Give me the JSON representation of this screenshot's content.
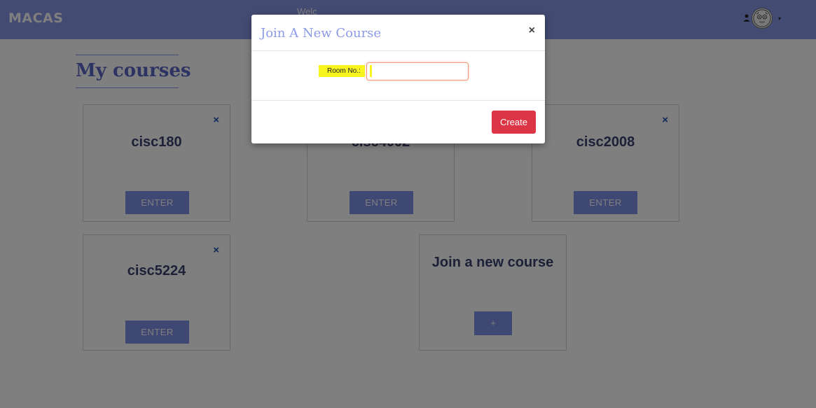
{
  "navbar": {
    "brand": "MACAS",
    "welcome_text": "Welc",
    "user_icon": "person-icon",
    "avatar_icon": "avatar-face-icon",
    "caret_icon": "caret-down-icon"
  },
  "page": {
    "title": "My courses"
  },
  "courses": [
    {
      "name": "cisc180",
      "enter_label": "ENTER",
      "remove_icon": "close-icon"
    },
    {
      "name": "cisc4002",
      "enter_label": "ENTER",
      "remove_icon": "close-icon"
    },
    {
      "name": "cisc2008",
      "enter_label": "ENTER",
      "remove_icon": "close-icon"
    },
    {
      "name": "cisc5224",
      "enter_label": "ENTER",
      "remove_icon": "close-icon"
    }
  ],
  "join_card": {
    "title": "Join a new course",
    "plus_label": "+"
  },
  "modal": {
    "title": "Join A New Course",
    "close_label": "×",
    "room_label": "Room No.:",
    "room_value": "",
    "create_label": "Create"
  },
  "colors": {
    "navbar": "#8896e6",
    "button": "#7f8fe6",
    "create_button": "#dc3545",
    "highlight": "#f7f51d"
  }
}
